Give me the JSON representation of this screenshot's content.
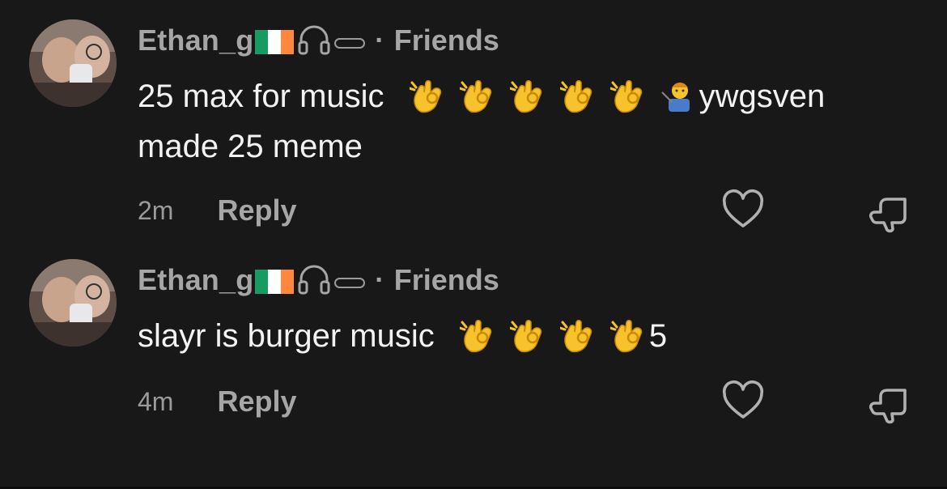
{
  "comments": [
    {
      "username": "Ethan_g",
      "friend_label": "Friends",
      "dot": "·",
      "text_line1": "25 max for music",
      "ok_emoji_count": 5,
      "after_emoji_text": "ywgsven",
      "text_line2": "made 25 meme",
      "time": "2m",
      "reply_label": "Reply"
    },
    {
      "username": "Ethan_g",
      "friend_label": "Friends",
      "dot": "·",
      "text_line1": "slayr is burger music",
      "ok_emoji_count": 4,
      "after_emoji_text": "5",
      "time": "4m",
      "reply_label": "Reply"
    }
  ],
  "icons": {
    "flag": "ireland-flag-icon",
    "headphones": "headphones-icon",
    "pill": "pill-toggle-icon",
    "ok_hand": "ok-hand-emoji",
    "teacher": "teacher-emoji",
    "like": "heart-icon",
    "dislike": "thumbs-down-icon"
  },
  "colors": {
    "background": "#181818",
    "text_primary": "#f2f2f2",
    "text_secondary": "#a6a6a6",
    "flag_green": "#169b62",
    "flag_white": "#ffffff",
    "flag_orange": "#ff883e",
    "emoji_yellow": "#f7c22c"
  }
}
